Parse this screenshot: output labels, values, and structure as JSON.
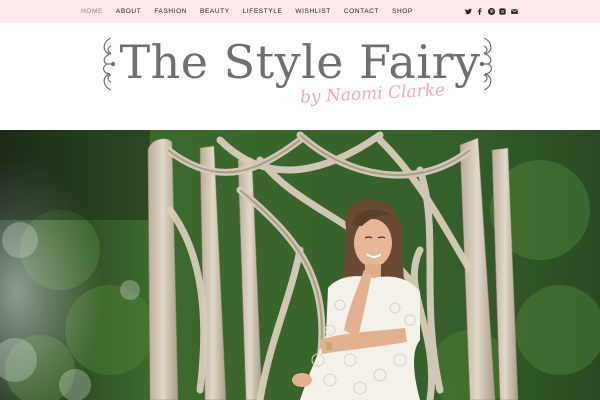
{
  "nav": {
    "items": [
      {
        "label": "HOME",
        "active": true
      },
      {
        "label": "ABOUT"
      },
      {
        "label": "FASHION"
      },
      {
        "label": "BEAUTY"
      },
      {
        "label": "LIFESTYLE"
      },
      {
        "label": "WISHLIST"
      },
      {
        "label": "CONTACT"
      },
      {
        "label": "SHOP"
      }
    ]
  },
  "social": [
    "twitter-icon",
    "facebook-icon",
    "pinterest-icon",
    "instagram-icon",
    "email-icon"
  ],
  "logo": {
    "title": "The Style Fairy",
    "subtitle": "by Naomi Clarke"
  },
  "colors": {
    "topbar_bg": "#fce8e8",
    "title": "#6f6f6f",
    "subtitle": "#f1a9bd"
  }
}
